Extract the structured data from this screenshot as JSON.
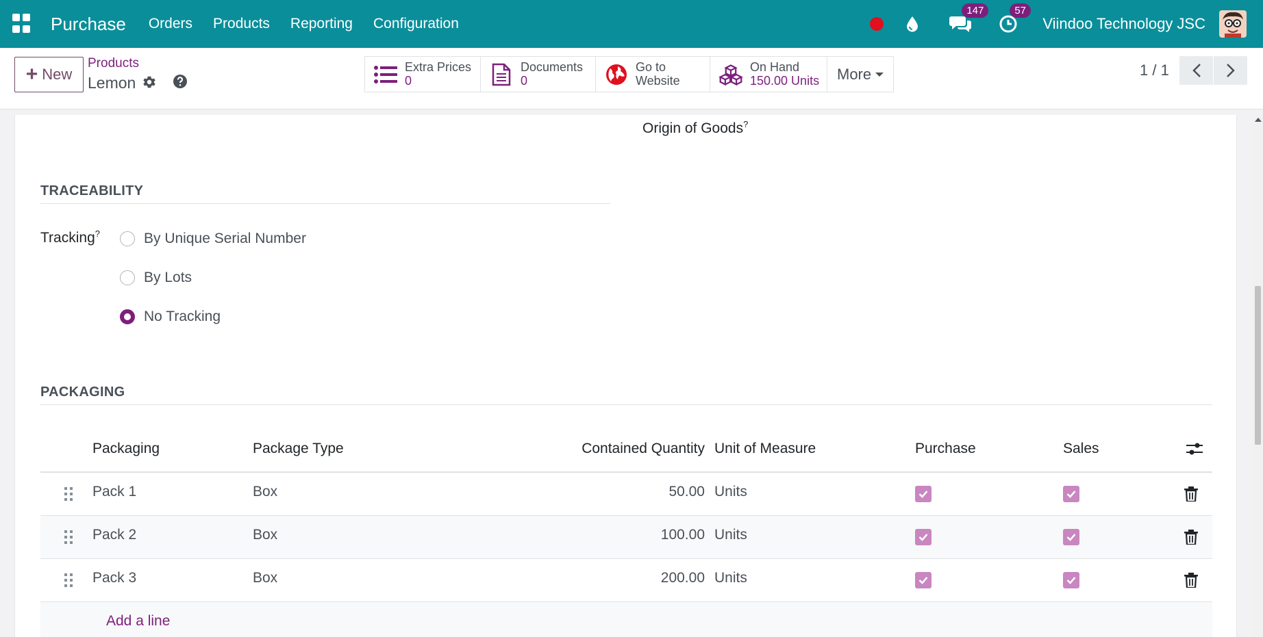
{
  "navbar": {
    "app_name": "Purchase",
    "menu": [
      "Orders",
      "Products",
      "Reporting",
      "Configuration"
    ],
    "messages_badge": "147",
    "activities_badge": "57",
    "company": "Viindoo Technology JSC",
    "icons": [
      "apps-grid-icon",
      "record-dot-icon",
      "droplet-icon",
      "chat-icon",
      "clock-icon"
    ]
  },
  "control": {
    "new_label": "New",
    "breadcrumb_parent": "Products",
    "record_name": "Lemon",
    "smart_buttons": {
      "extra_prices": {
        "label": "Extra Prices",
        "value": "0"
      },
      "documents": {
        "label": "Documents",
        "value": "0"
      },
      "website": {
        "line1": "Go to",
        "line2": "Website"
      },
      "on_hand": {
        "label": "On Hand",
        "value": "150.00 Units"
      },
      "more": "More"
    },
    "pager": "1 / 1"
  },
  "form": {
    "origin_label": "Origin of Goods",
    "traceability_title": "TRACEABILITY",
    "tracking_label": "Tracking",
    "help_mark": "?",
    "tracking_options": [
      {
        "label": "By Unique Serial Number",
        "checked": false
      },
      {
        "label": "By Lots",
        "checked": false
      },
      {
        "label": "No Tracking",
        "checked": true
      }
    ],
    "packaging_title": "PACKAGING",
    "table": {
      "headers": [
        "Packaging",
        "Package Type",
        "Contained Quantity",
        "Unit of Measure",
        "Purchase",
        "Sales"
      ],
      "rows": [
        {
          "packaging": "Pack 1",
          "type": "Box",
          "qty": "50.00",
          "uom": "Units",
          "purchase": true,
          "sales": true
        },
        {
          "packaging": "Pack 2",
          "type": "Box",
          "qty": "100.00",
          "uom": "Units",
          "purchase": true,
          "sales": true
        },
        {
          "packaging": "Pack 3",
          "type": "Box",
          "qty": "200.00",
          "uom": "Units",
          "purchase": true,
          "sales": true
        }
      ],
      "add_line": "Add a line"
    }
  },
  "colors": {
    "navbar": "#0a8e9a",
    "primary": "#7c1f7c",
    "checkbox": "#c986c0",
    "record": "#e0101f"
  }
}
